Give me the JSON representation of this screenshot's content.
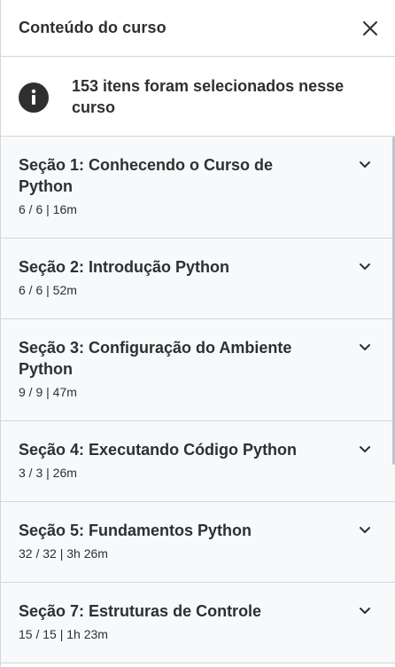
{
  "header": {
    "title": "Conteúdo do curso",
    "close_icon": "close-icon"
  },
  "notice": {
    "icon": "info-icon",
    "text": "153 itens foram selecionados nesse curso"
  },
  "sections": [
    {
      "title": "Seção 1: Conhecendo o Curso de Python",
      "meta": "6 / 6 | 16m"
    },
    {
      "title": "Seção 2: Introdução Python",
      "meta": "6 / 6 | 52m"
    },
    {
      "title": "Seção 3: Configuração do Ambiente Python",
      "meta": "9 / 9 | 47m"
    },
    {
      "title": "Seção 4: Executando Código Python",
      "meta": "3 / 3 | 26m"
    },
    {
      "title": "Seção 5: Fundamentos Python",
      "meta": "32 / 32 | 3h 26m"
    },
    {
      "title": "Seção 7: Estruturas de Controle",
      "meta": "15 / 15 | 1h 23m"
    }
  ],
  "colors": {
    "text": "#2d2f31",
    "section_bg": "#f7f9fa",
    "border": "#d1d7dc"
  }
}
